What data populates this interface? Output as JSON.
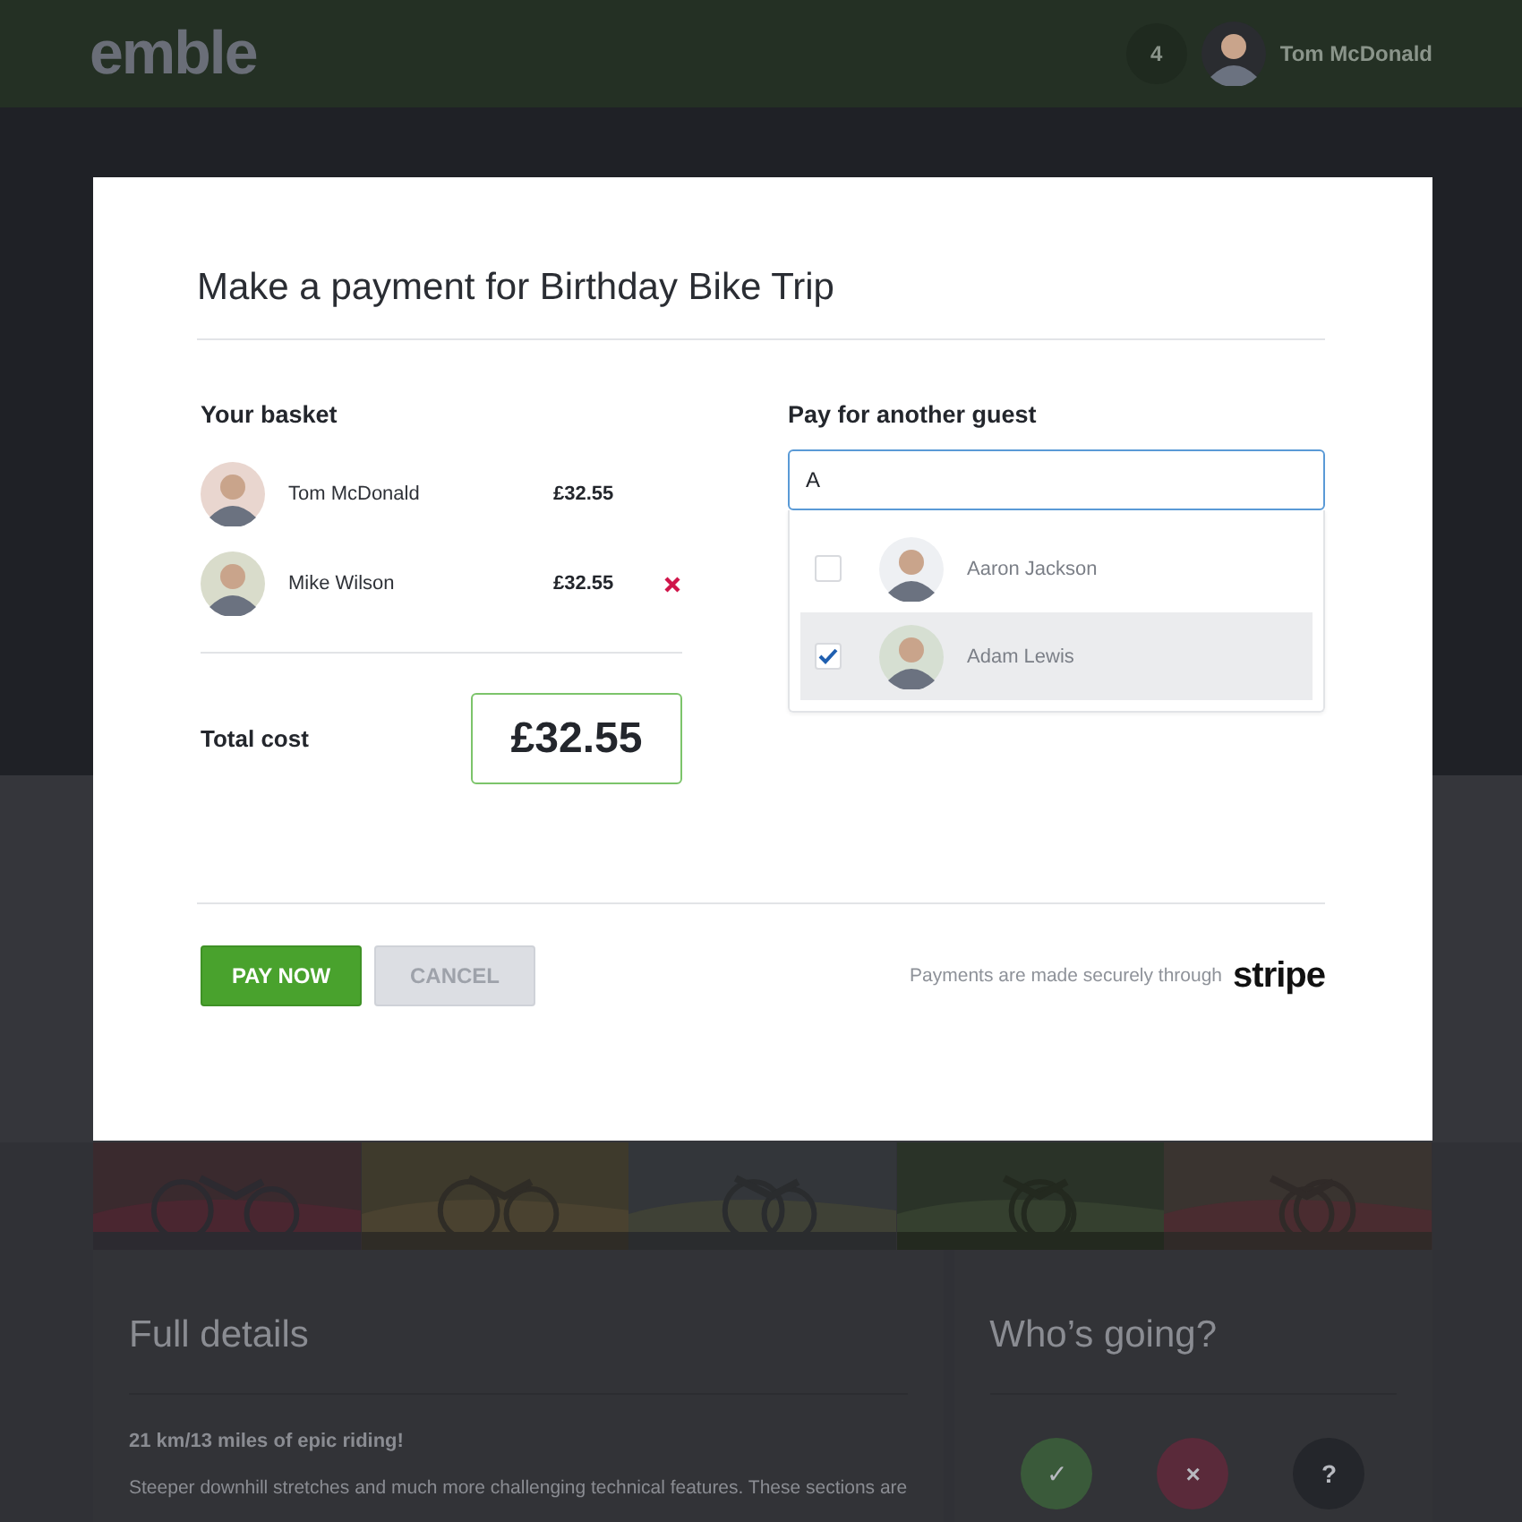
{
  "header": {
    "logo": "emble",
    "notification_count": "4",
    "user_name": "Tom McDonald"
  },
  "details": {
    "title": "Full details",
    "subtitle": "21 km/13 miles of epic riding!",
    "body": "Steeper downhill stretches and much more challenging technical features. These sections are"
  },
  "attendance": {
    "title": "Who’s going?",
    "options": [
      {
        "kind": "yes",
        "label": "✓"
      },
      {
        "kind": "no",
        "label": "×"
      },
      {
        "kind": "maybe",
        "label": "?"
      }
    ]
  },
  "modal": {
    "title": "Make a payment for Birthday Bike Trip",
    "basket": {
      "heading": "Your basket",
      "items": [
        {
          "name": "Tom McDonald",
          "price": "£32.55",
          "removable": false
        },
        {
          "name": "Mike Wilson",
          "price": "£32.55",
          "removable": true
        }
      ]
    },
    "total": {
      "label": "Total cost",
      "amount": "£32.55"
    },
    "guest_search": {
      "heading": "Pay for another guest",
      "value": "A",
      "results": [
        {
          "name": "Aaron Jackson",
          "selected": false
        },
        {
          "name": "Adam Lewis",
          "selected": true
        }
      ]
    },
    "buttons": [
      {
        "kind": "primary",
        "label": "PAY NOW"
      },
      {
        "kind": "secondary",
        "label": "CANCEL"
      }
    ],
    "footer_note": "Payments are made securely through",
    "brand": "stripe"
  }
}
